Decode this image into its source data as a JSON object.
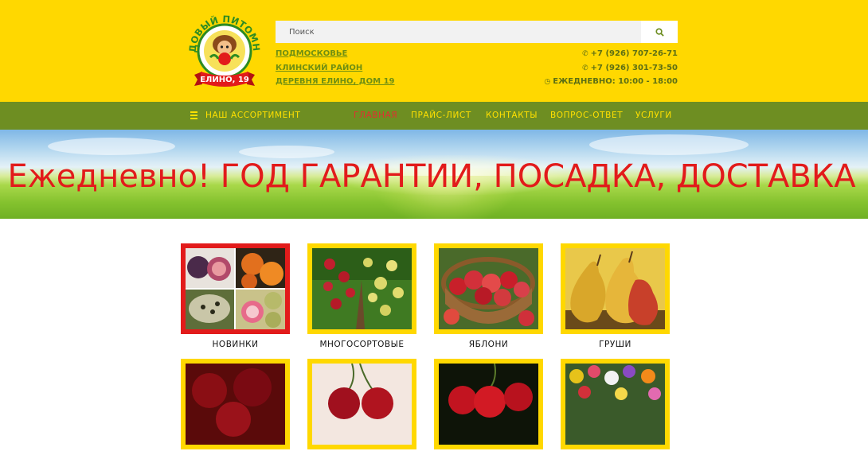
{
  "header": {
    "logo": {
      "top_text": "САДОВЫЙ ПИТОМНИК",
      "ribbon_text": "ЕЛИНО, 19"
    },
    "search": {
      "placeholder": "Поиск",
      "button_icon": "search-icon"
    },
    "address": [
      "ПОДМОСКОВЬЕ",
      "КЛИНСКИЙ РАЙОН",
      "ДЕРЕВНЯ ЕЛИНО, ДОМ 19"
    ],
    "phones": [
      "+7 (926) 707-26-71",
      "+7 (926) 301-73-50"
    ],
    "hours": "ЕЖЕДНЕВНО: 10:00 - 18:00",
    "colors": {
      "background": "#ffd800",
      "link": "#6f8f12"
    }
  },
  "nav": {
    "catalog": {
      "label": "НАШ АССОРТИМЕНТ",
      "icon": "menu-icon"
    },
    "items": [
      {
        "label": "ГЛАВНАЯ",
        "active": true
      },
      {
        "label": "ПРАЙС-ЛИСТ",
        "active": false
      },
      {
        "label": "КОНТАКТЫ",
        "active": false
      },
      {
        "label": "ВОПРОС-ОТВЕТ",
        "active": false
      },
      {
        "label": "УСЛУГИ",
        "active": false
      }
    ],
    "colors": {
      "background": "#6e8e22",
      "text": "#ffe000",
      "active": "#e03030"
    }
  },
  "banner": {
    "text": "ем Ежедневно! ГОД ГАРАНТИИ, ПОСАДКА, ДОСТАВКА",
    "color": "#e21b1b"
  },
  "categories": [
    {
      "label": "НОВИНКИ",
      "border": "#e21b1b",
      "image": "exotic-fruits-collage"
    },
    {
      "label": "МНОГОСОРТОВЫЕ",
      "border": "#ffd800",
      "image": "multi-variety-apple-tree"
    },
    {
      "label": "ЯБЛОНИ",
      "border": "#ffd800",
      "image": "apples-basket"
    },
    {
      "label": "ГРУШИ",
      "border": "#ffd800",
      "image": "pears"
    },
    {
      "label": "",
      "border": "#ffd800",
      "image": "cherries"
    },
    {
      "label": "",
      "border": "#ffd800",
      "image": "sweet-cherries"
    },
    {
      "label": "",
      "border": "#ffd800",
      "image": "cherries-dark"
    },
    {
      "label": "",
      "border": "#ffd800",
      "image": "flowers"
    }
  ]
}
